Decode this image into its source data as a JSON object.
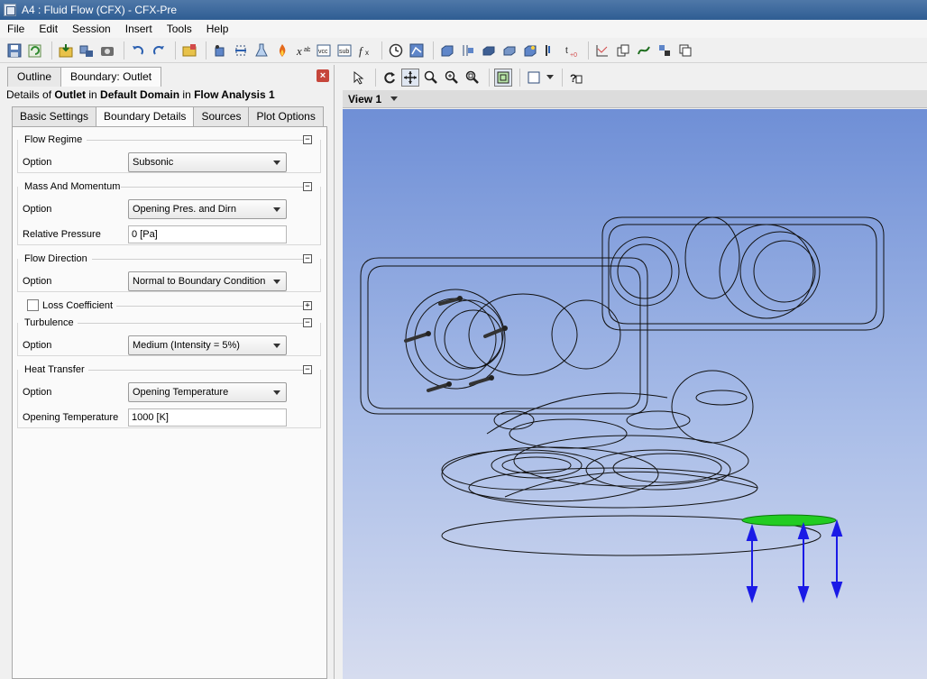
{
  "window": {
    "title": "A4 : Fluid Flow (CFX) - CFX-Pre"
  },
  "menu": [
    "File",
    "Edit",
    "Session",
    "Insert",
    "Tools",
    "Help"
  ],
  "toolbar_icons": [
    "save-icon",
    "refresh-icon",
    "import-icon",
    "export-icon",
    "camera-icon",
    "undo-icon",
    "redo-icon",
    "folder-icon",
    "domain-icon",
    "boundary-icon",
    "flask-icon",
    "flame-icon",
    "expression-icon",
    "vcc-icon",
    "sub-icon",
    "function-icon",
    "clock-icon",
    "solver-icon",
    "box1-icon",
    "box2-icon",
    "box3-icon",
    "box4-icon",
    "box5-icon",
    "monitor-icon",
    "tplus-icon",
    "chart-icon",
    "copy-icon",
    "flow-icon",
    "mesh-icon",
    "layers-icon"
  ],
  "outline_panel": {
    "tab_outline": "Outline",
    "tab_boundary": "Boundary: Outlet",
    "close_label": "×",
    "details": {
      "prefix": "Details of ",
      "object": "Outlet",
      "in1": " in ",
      "domain": "Default Domain",
      "in2": " in ",
      "analysis": "Flow Analysis 1"
    },
    "sub_tabs": [
      "Basic Settings",
      "Boundary Details",
      "Sources",
      "Plot Options"
    ],
    "flow_regime": {
      "title": "Flow Regime",
      "option_label": "Option",
      "option_value": "Subsonic"
    },
    "mass_momentum": {
      "title": "Mass And Momentum",
      "option_label": "Option",
      "option_value": "Opening Pres. and Dirn",
      "pressure_label": "Relative Pressure",
      "pressure_value": "0 [Pa]"
    },
    "flow_direction": {
      "title": "Flow Direction",
      "option_label": "Option",
      "option_value": "Normal to Boundary Condition"
    },
    "loss_coefficient": {
      "title": "Loss Coefficient"
    },
    "turbulence": {
      "title": "Turbulence",
      "option_label": "Option",
      "option_value": "Medium (Intensity = 5%)"
    },
    "heat_transfer": {
      "title": "Heat Transfer",
      "option_label": "Option",
      "option_value": "Opening Temperature",
      "temp_label": "Opening Temperature",
      "temp_value": "1000 [K]"
    },
    "collapse_symbol": "−",
    "expand_symbol": "+"
  },
  "view": {
    "name": "View 1"
  },
  "colors": {
    "outlet_highlight": "#22cc22",
    "arrow_blue": "#1a1ae6",
    "wire": "#111111"
  }
}
